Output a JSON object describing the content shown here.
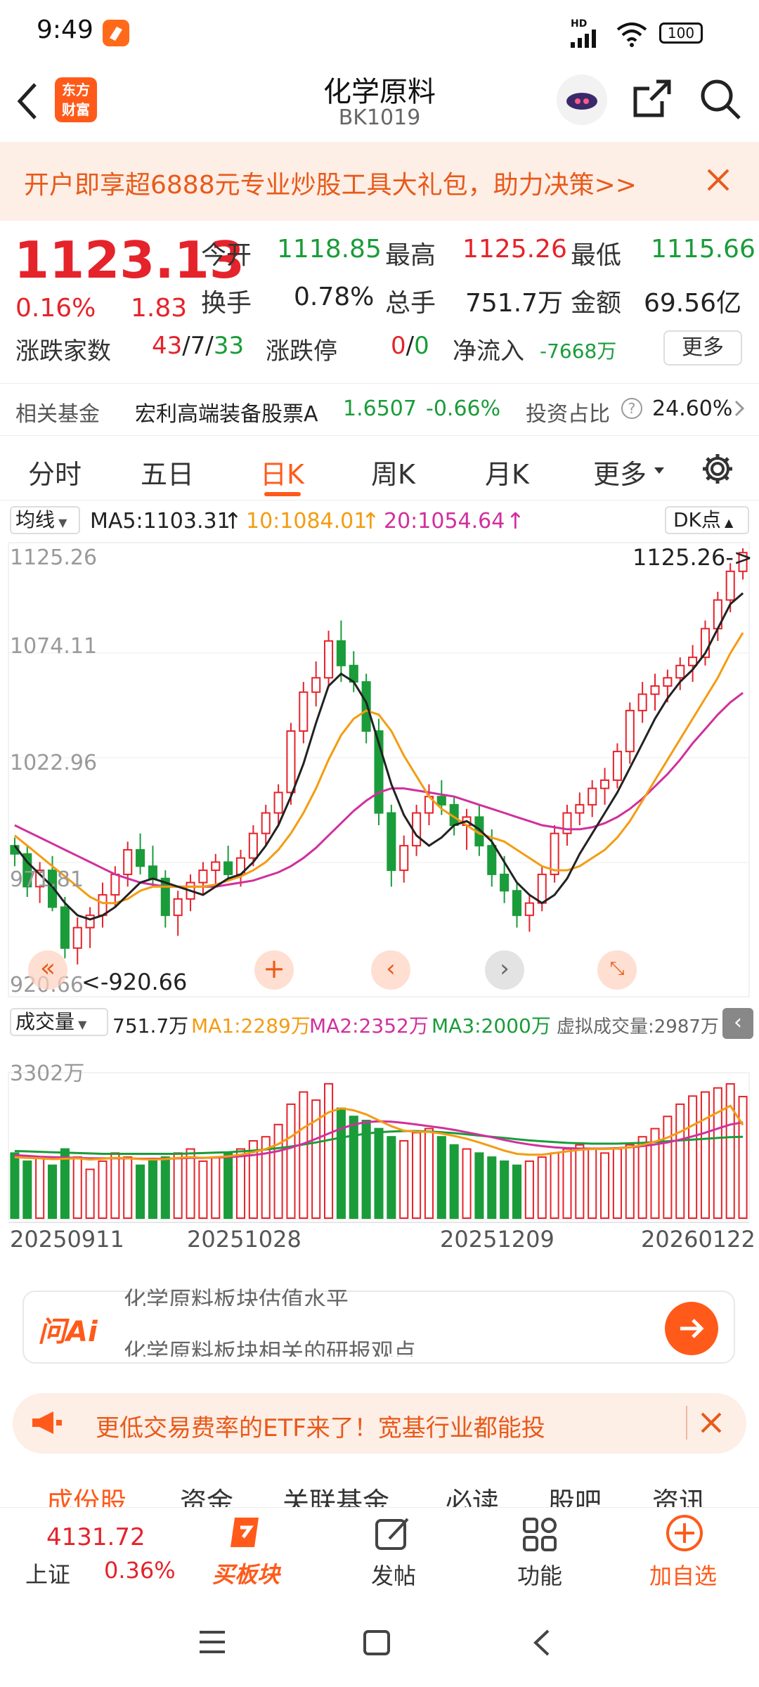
{
  "status": {
    "time": "9:49",
    "battery": "100",
    "network": "HD"
  },
  "header": {
    "title": "化学原料",
    "code": "BK1019",
    "logo_text_1": "东方",
    "logo_text_2": "财富"
  },
  "banner": {
    "text": "开户即享超6888元专业炒股工具大礼包，助力决策>>"
  },
  "quote": {
    "price": "1123.13",
    "change_pct": "0.16%",
    "change": "1.83",
    "open_label": "今开",
    "open": "1118.85",
    "high_label": "最高",
    "high": "1125.26",
    "low_label": "最低",
    "low": "1115.66",
    "turnover_label": "换手",
    "turnover": "0.78%",
    "volume_label": "总手",
    "volume": "751.7万",
    "amount_label": "金额",
    "amount": "69.56亿",
    "breadth_label": "涨跌家数",
    "breadth_up": "43",
    "breadth_sep1": "/",
    "breadth_flat": "7",
    "breadth_sep2": "/",
    "breadth_down": "33",
    "limit_label": "涨跌停",
    "limit_up": "0",
    "limit_sep": "/",
    "limit_down": "0",
    "netflow_label": "净流入",
    "netflow": "-7668万",
    "more_label": "更多"
  },
  "fund": {
    "label": "相关基金",
    "name": "宏利高端装备股票A",
    "nav": "1.6507",
    "chg": "-0.66%",
    "ratio_label": "投资占比",
    "ratio": "24.60%"
  },
  "tabs": [
    "分时",
    "五日",
    "日K",
    "周K",
    "月K",
    "更多"
  ],
  "active_tab": 2,
  "ma_bar": {
    "selector": "均线",
    "ma5": "MA5:1103.31",
    "ma10": "10:1084.01",
    "ma20": "20:1054.64",
    "dk": "DK点"
  },
  "price_axis": [
    "1125.26",
    "1074.11",
    "1022.96",
    "971.81",
    "920.66"
  ],
  "annotations": {
    "high": "1125.26->",
    "low": "<-920.66"
  },
  "vol_bar": {
    "selector": "成交量",
    "vol": "751.7万",
    "ma1": "MA1:2289万",
    "ma2": "MA2:2352万",
    "ma3": "MA3:2000万",
    "virtual": "虚拟成交量:2987万"
  },
  "vol_axis_top": "3302万",
  "date_axis": [
    "20250911",
    "20251028",
    "20251209",
    "20260122"
  ],
  "ai": {
    "logo": "问Ai",
    "line1": "化学原料板块估值水平",
    "line2": "化学原料板块相关的研报观点"
  },
  "etf": {
    "text": "更低交易费率的ETF来了！宽基行业都能投"
  },
  "subtabs": [
    "成份股",
    "资金",
    "关联基金",
    "必读",
    "股吧",
    "资讯"
  ],
  "bottom": {
    "index_value": "4131.72",
    "index_name": "上证",
    "index_chg": "0.36%",
    "buy": "买板块",
    "post": "发帖",
    "func": "功能",
    "add": "加自选"
  },
  "colors": {
    "up": "#e5232b",
    "down": "#1a9c3a",
    "accent": "#ff6a1a",
    "ma5": "#222222",
    "ma10": "#f39c12",
    "ma20": "#d0309d"
  },
  "chart_data": {
    "type": "candlestick",
    "ylim": [
      920.66,
      1125.26
    ],
    "candles": [
      [
        980,
        984,
        970,
        976
      ],
      [
        976,
        980,
        955,
        960
      ],
      [
        960,
        972,
        952,
        968
      ],
      [
        968,
        975,
        948,
        950
      ],
      [
        950,
        955,
        925,
        930
      ],
      [
        930,
        945,
        922,
        940
      ],
      [
        940,
        950,
        930,
        946
      ],
      [
        946,
        962,
        940,
        956
      ],
      [
        956,
        970,
        950,
        966
      ],
      [
        966,
        982,
        960,
        978
      ],
      [
        978,
        986,
        966,
        970
      ],
      [
        970,
        980,
        960,
        964
      ],
      [
        964,
        968,
        940,
        946
      ],
      [
        946,
        958,
        936,
        954
      ],
      [
        954,
        966,
        948,
        962
      ],
      [
        962,
        972,
        956,
        968
      ],
      [
        968,
        976,
        960,
        972
      ],
      [
        972,
        980,
        964,
        966
      ],
      [
        966,
        978,
        960,
        974
      ],
      [
        974,
        990,
        970,
        986
      ],
      [
        986,
        1000,
        980,
        996
      ],
      [
        996,
        1010,
        990,
        1006
      ],
      [
        1006,
        1040,
        1000,
        1036
      ],
      [
        1036,
        1060,
        1030,
        1055
      ],
      [
        1055,
        1070,
        1048,
        1062
      ],
      [
        1062,
        1085,
        1058,
        1080
      ],
      [
        1080,
        1090,
        1060,
        1068
      ],
      [
        1068,
        1075,
        1055,
        1060
      ],
      [
        1060,
        1064,
        1030,
        1036
      ],
      [
        1036,
        1042,
        990,
        996
      ],
      [
        996,
        1000,
        960,
        968
      ],
      [
        968,
        985,
        962,
        980
      ],
      [
        980,
        1000,
        975,
        996
      ],
      [
        996,
        1010,
        990,
        1004
      ],
      [
        1004,
        1012,
        995,
        1000
      ],
      [
        1000,
        1004,
        985,
        990
      ],
      [
        990,
        998,
        978,
        994
      ],
      [
        994,
        1000,
        975,
        980
      ],
      [
        980,
        988,
        960,
        966
      ],
      [
        966,
        975,
        952,
        958
      ],
      [
        958,
        962,
        940,
        946
      ],
      [
        946,
        956,
        938,
        952
      ],
      [
        952,
        970,
        948,
        966
      ],
      [
        966,
        990,
        962,
        986
      ],
      [
        986,
        1000,
        980,
        996
      ],
      [
        996,
        1006,
        990,
        1000
      ],
      [
        1000,
        1012,
        994,
        1008
      ],
      [
        1008,
        1018,
        1000,
        1012
      ],
      [
        1012,
        1030,
        1008,
        1026
      ],
      [
        1026,
        1050,
        1020,
        1046
      ],
      [
        1046,
        1060,
        1040,
        1054
      ],
      [
        1054,
        1064,
        1046,
        1058
      ],
      [
        1058,
        1066,
        1050,
        1062
      ],
      [
        1062,
        1072,
        1056,
        1068
      ],
      [
        1068,
        1078,
        1060,
        1072
      ],
      [
        1072,
        1090,
        1068,
        1086
      ],
      [
        1086,
        1104,
        1080,
        1100
      ],
      [
        1100,
        1118,
        1094,
        1114
      ],
      [
        1114,
        1125.26,
        1110,
        1123.13
      ]
    ],
    "ma5": [
      980,
      972,
      966,
      960,
      952,
      946,
      944,
      946,
      950,
      956,
      962,
      964,
      962,
      960,
      958,
      956,
      960,
      964,
      966,
      972,
      980,
      990,
      1004,
      1020,
      1040,
      1058,
      1064,
      1060,
      1050,
      1030,
      1010,
      995,
      985,
      980,
      984,
      990,
      992,
      988,
      982,
      972,
      962,
      956,
      952,
      956,
      964,
      976,
      986,
      996,
      1006,
      1018,
      1030,
      1042,
      1052,
      1060,
      1066,
      1074,
      1086,
      1098,
      1103.31
    ],
    "ma10": [
      985,
      980,
      975,
      970,
      965,
      960,
      955,
      952,
      952,
      954,
      958,
      960,
      960,
      960,
      960,
      960,
      961,
      963,
      965,
      968,
      972,
      978,
      986,
      996,
      1008,
      1022,
      1034,
      1042,
      1046,
      1044,
      1036,
      1024,
      1014,
      1004,
      998,
      994,
      990,
      986,
      984,
      982,
      978,
      974,
      970,
      968,
      968,
      970,
      974,
      978,
      984,
      992,
      1002,
      1012,
      1022,
      1032,
      1042,
      1052,
      1062,
      1074,
      1084.01
    ],
    "ma20": [
      990,
      987,
      984,
      981,
      978,
      975,
      972,
      969,
      966,
      964,
      962,
      961,
      960,
      960,
      960,
      960,
      960,
      961,
      962,
      963,
      965,
      967,
      970,
      974,
      979,
      985,
      991,
      997,
      1002,
      1006,
      1008,
      1008,
      1007,
      1006,
      1005,
      1004,
      1002,
      1000,
      998,
      996,
      994,
      992,
      990,
      989,
      988,
      988,
      989,
      991,
      994,
      998,
      1003,
      1009,
      1015,
      1022,
      1030,
      1037,
      1044,
      1050,
      1054.64
    ],
    "volume": [
      1600,
      1400,
      1500,
      1300,
      1700,
      1500,
      1200,
      1400,
      1600,
      1500,
      1300,
      1400,
      1500,
      1600,
      1700,
      1400,
      1500,
      1600,
      1700,
      1900,
      2000,
      2300,
      2800,
      3100,
      2900,
      3302,
      2700,
      2500,
      2400,
      2200,
      2000,
      1900,
      2100,
      2200,
      2000,
      1800,
      1700,
      1600,
      1500,
      1400,
      1300,
      1400,
      1500,
      1600,
      1700,
      1800,
      1700,
      1600,
      1700,
      1800,
      2000,
      2200,
      2500,
      2800,
      3000,
      3100,
      3200,
      3300,
      2987
    ],
    "vol_ma1": [
      1500,
      1480,
      1470,
      1450,
      1460,
      1470,
      1440,
      1460,
      1480,
      1470,
      1450,
      1440,
      1450,
      1480,
      1500,
      1480,
      1500,
      1520,
      1560,
      1620,
      1700,
      1820,
      2000,
      2220,
      2400,
      2600,
      2700,
      2650,
      2550,
      2400,
      2260,
      2150,
      2120,
      2120,
      2080,
      2020,
      1950,
      1860,
      1760,
      1660,
      1580,
      1560,
      1560,
      1600,
      1640,
      1680,
      1700,
      1700,
      1710,
      1740,
      1800,
      1880,
      1980,
      2120,
      2280,
      2440,
      2600,
      2760,
      2289
    ],
    "vol_ma2": [
      1550,
      1530,
      1510,
      1500,
      1490,
      1480,
      1470,
      1470,
      1470,
      1470,
      1460,
      1460,
      1460,
      1470,
      1480,
      1480,
      1490,
      1500,
      1520,
      1550,
      1590,
      1650,
      1730,
      1830,
      1950,
      2080,
      2200,
      2300,
      2360,
      2380,
      2370,
      2340,
      2300,
      2260,
      2220,
      2170,
      2110,
      2050,
      1990,
      1920,
      1860,
      1810,
      1770,
      1740,
      1720,
      1710,
      1710,
      1710,
      1720,
      1740,
      1770,
      1810,
      1860,
      1930,
      2010,
      2100,
      2200,
      2300,
      2352
    ],
    "vol_ma3": [
      1650,
      1640,
      1630,
      1620,
      1610,
      1600,
      1590,
      1580,
      1580,
      1580,
      1580,
      1580,
      1580,
      1580,
      1590,
      1600,
      1610,
      1620,
      1640,
      1660,
      1690,
      1720,
      1760,
      1810,
      1860,
      1920,
      1980,
      2030,
      2080,
      2110,
      2130,
      2140,
      2140,
      2130,
      2110,
      2090,
      2060,
      2030,
      2000,
      1970,
      1940,
      1910,
      1890,
      1870,
      1850,
      1840,
      1830,
      1830,
      1830,
      1840,
      1850,
      1870,
      1890,
      1910,
      1930,
      1950,
      1970,
      1990,
      2000
    ]
  }
}
